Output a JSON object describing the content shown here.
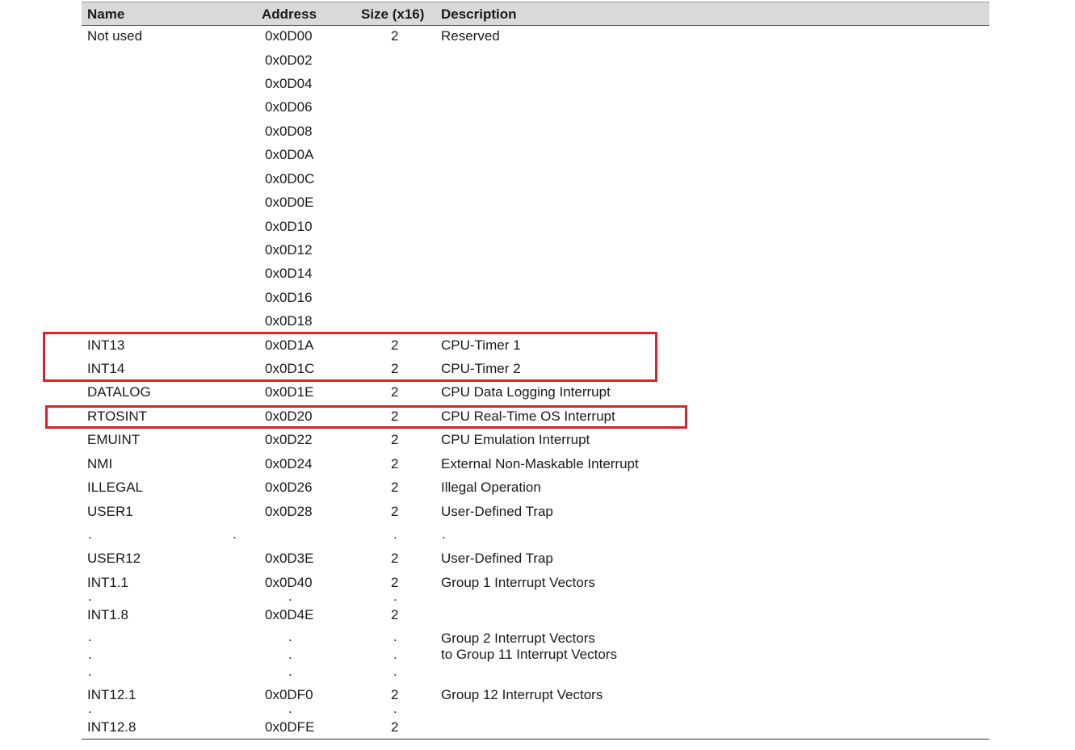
{
  "table": {
    "headers": {
      "name": "Name",
      "address": "Address",
      "size": "Size (x16)",
      "description": "Description"
    },
    "rows": [
      {
        "name": "Not used",
        "address": "0x0D00",
        "size": "2",
        "description": "Reserved"
      },
      {
        "name": "",
        "address": "0x0D02",
        "size": "",
        "description": ""
      },
      {
        "name": "",
        "address": "0x0D04",
        "size": "",
        "description": ""
      },
      {
        "name": "",
        "address": "0x0D06",
        "size": "",
        "description": ""
      },
      {
        "name": "",
        "address": "0x0D08",
        "size": "",
        "description": ""
      },
      {
        "name": "",
        "address": "0x0D0A",
        "size": "",
        "description": ""
      },
      {
        "name": "",
        "address": "0x0D0C",
        "size": "",
        "description": ""
      },
      {
        "name": "",
        "address": "0x0D0E",
        "size": "",
        "description": ""
      },
      {
        "name": "",
        "address": "0x0D10",
        "size": "",
        "description": ""
      },
      {
        "name": "",
        "address": "0x0D12",
        "size": "",
        "description": ""
      },
      {
        "name": "",
        "address": "0x0D14",
        "size": "",
        "description": ""
      },
      {
        "name": "",
        "address": "0x0D16",
        "size": "",
        "description": ""
      },
      {
        "name": "",
        "address": "0x0D18",
        "size": "",
        "description": ""
      },
      {
        "name": "INT13",
        "address": "0x0D1A",
        "size": "2",
        "description": "CPU-Timer 1"
      },
      {
        "name": "INT14",
        "address": "0x0D1C",
        "size": "2",
        "description": "CPU-Timer 2"
      },
      {
        "name": "DATALOG",
        "address": "0x0D1E",
        "size": "2",
        "description": "CPU Data Logging Interrupt"
      },
      {
        "name": "RTOSINT",
        "address": "0x0D20",
        "size": "2",
        "description": "CPU Real-Time OS Interrupt"
      },
      {
        "name": "EMUINT",
        "address": "0x0D22",
        "size": "2",
        "description": "CPU Emulation Interrupt"
      },
      {
        "name": "NMI",
        "address": "0x0D24",
        "size": "2",
        "description": "External Non-Maskable Interrupt"
      },
      {
        "name": "ILLEGAL",
        "address": "0x0D26",
        "size": "2",
        "description": "Illegal Operation"
      },
      {
        "name": "USER1",
        "address": "0x0D28",
        "size": "2",
        "description": "User-Defined Trap"
      },
      {
        "name": "USER12",
        "address": "0x0D3E",
        "size": "2",
        "description": "User-Defined Trap"
      },
      {
        "name": "INT1.1",
        "address": "0x0D40",
        "size": "2",
        "description": "Group 1 Interrupt Vectors"
      },
      {
        "name": "INT1.8",
        "address": "0x0D4E",
        "size": "2",
        "description": ""
      },
      {
        "name": "",
        "address": "",
        "size": "",
        "description": "Group 2 Interrupt Vectors"
      },
      {
        "name": "",
        "address": "",
        "size": "",
        "description": "to Group 11 Interrupt Vectors"
      },
      {
        "name": "INT12.1",
        "address": "0x0DF0",
        "size": "2",
        "description": "Group 12 Interrupt Vectors"
      },
      {
        "name": "INT12.8",
        "address": "0x0DFE",
        "size": "2",
        "description": ""
      }
    ],
    "ellipsis_dot": "."
  }
}
